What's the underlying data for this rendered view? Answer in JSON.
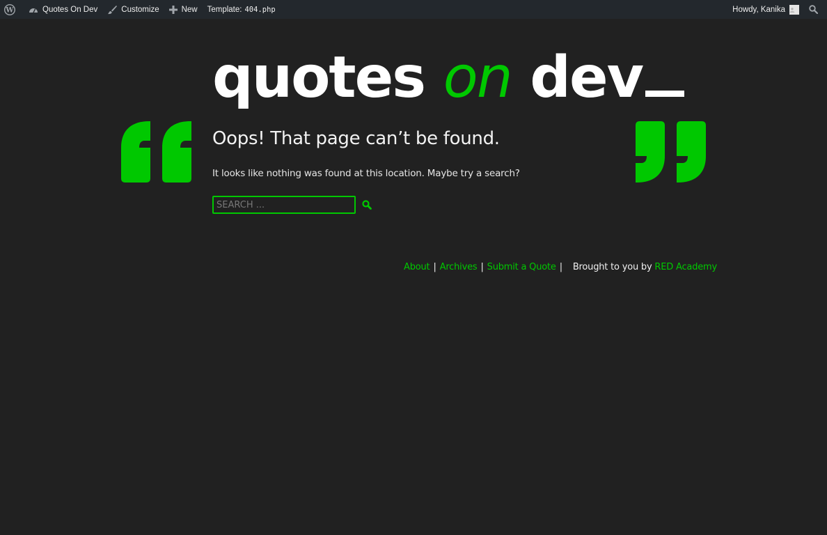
{
  "adminbar": {
    "site_name": "Quotes On Dev",
    "customize": "Customize",
    "new": "New",
    "template_label": "Template:",
    "template_file": "404.php",
    "howdy": "Howdy, Kanika"
  },
  "logo": {
    "word1": "quotes",
    "word2": "on",
    "word3": "dev"
  },
  "content": {
    "title": "Oops! That page can’t be found.",
    "message": "It looks like nothing was found at this location. Maybe try a search?"
  },
  "search": {
    "placeholder": "SEARCH ..."
  },
  "footer": {
    "links": [
      "About",
      "Archives",
      "Submit a Quote"
    ],
    "separator": "|",
    "credit_text": "Brought to you by",
    "credit_link": "RED Academy"
  },
  "colors": {
    "accent": "#00c800",
    "background": "#212121",
    "adminbar": "#23282d"
  }
}
